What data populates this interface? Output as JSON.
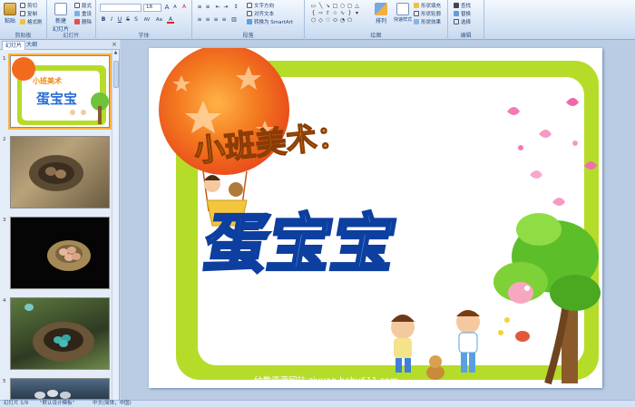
{
  "ribbon": {
    "clipboard": {
      "paste": "粘贴",
      "cut": "剪切",
      "copy": "复制",
      "format_painter": "格式刷",
      "label": "剪贴板"
    },
    "slides": {
      "new_slide": "新建",
      "new_slide2": "幻灯片",
      "layout": "版式",
      "reset": "重设",
      "delete": "删除",
      "label": "幻灯片"
    },
    "font": {
      "font_name": "",
      "font_size": "18",
      "grow": "A",
      "shrink": "A",
      "clear": "A",
      "bold": "B",
      "italic": "I",
      "underline": "U",
      "strike": "S",
      "shadow": "S",
      "spacing": "AV",
      "case": "Aa",
      "color": "A",
      "label": "字体"
    },
    "paragraph": {
      "text_direction": "文字方向",
      "align_text": "对齐文本",
      "smartart": "转换为 SmartArt",
      "label": "段落"
    },
    "drawing": {
      "arrange": "排列",
      "quick_styles": "快速样式",
      "shape_fill": "形状填充",
      "shape_outline": "形状轮廓",
      "shape_effects": "形状效果",
      "label": "绘图"
    },
    "editing": {
      "find": "查找",
      "replace": "替换",
      "select": "选择",
      "label": "编辑"
    }
  },
  "panel": {
    "tab_slides": "幻灯片",
    "tab_outline": "大纲",
    "close": "×",
    "thumbs": [
      {
        "num": "1"
      },
      {
        "num": "2"
      },
      {
        "num": "3"
      },
      {
        "num": "4"
      },
      {
        "num": "5"
      }
    ]
  },
  "slide": {
    "subtitle": "小班美术：",
    "title": "蛋宝宝",
    "footer": "幼教资源网站  ziyuan.baby611.com"
  },
  "status": {
    "slide_counter": "幻灯片 1/9",
    "theme": "\"默认设计模板\"",
    "language": "中文(简体，中国)"
  },
  "colors": {
    "frame_green": "#b6dc2a",
    "title_blue": "#2a6fd6",
    "subtitle_orange": "#f08a12",
    "balloon_orange": "#f26b1d"
  }
}
